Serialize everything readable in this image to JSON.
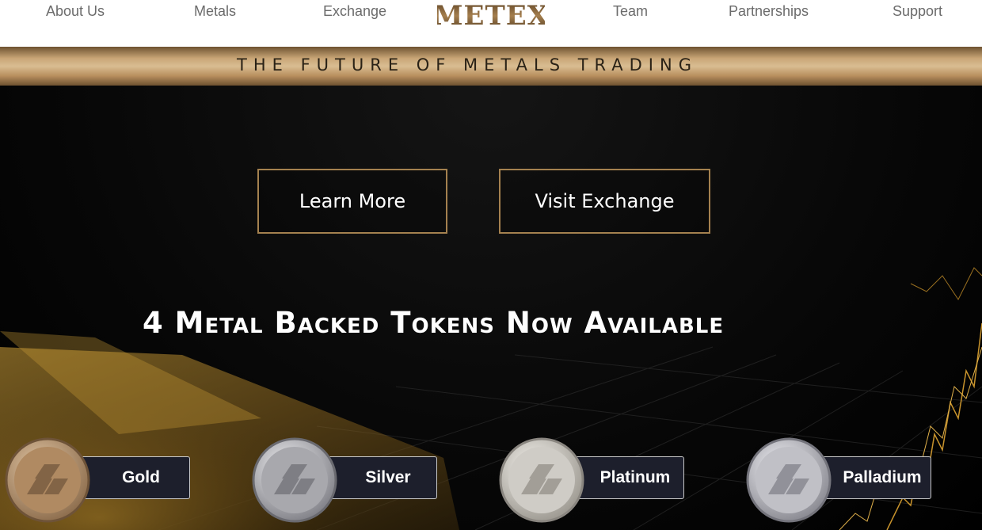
{
  "nav": {
    "items": [
      "About Us",
      "Metals",
      "Exchange",
      "Team",
      "Partnerships",
      "Support"
    ],
    "logo_text": "METEX"
  },
  "banner": {
    "tagline": "THE FUTURE OF METALS TRADING"
  },
  "hero": {
    "buttons": {
      "learn_more": "Learn More",
      "visit_exchange": "Visit Exchange"
    },
    "headline": "4 Metal Backed Tokens Now Available"
  },
  "tokens": [
    {
      "name": "Gold",
      "color": "#b08a62"
    },
    {
      "name": "Silver",
      "color": "#a8a8ad"
    },
    {
      "name": "Platinum",
      "color": "#cfccc6"
    },
    {
      "name": "Palladium",
      "color": "#c0c0c6"
    }
  ],
  "colors": {
    "accent": "#a4814f",
    "nav_text": "#6b6b6b",
    "token_label_bg": "#1d1f2c"
  }
}
